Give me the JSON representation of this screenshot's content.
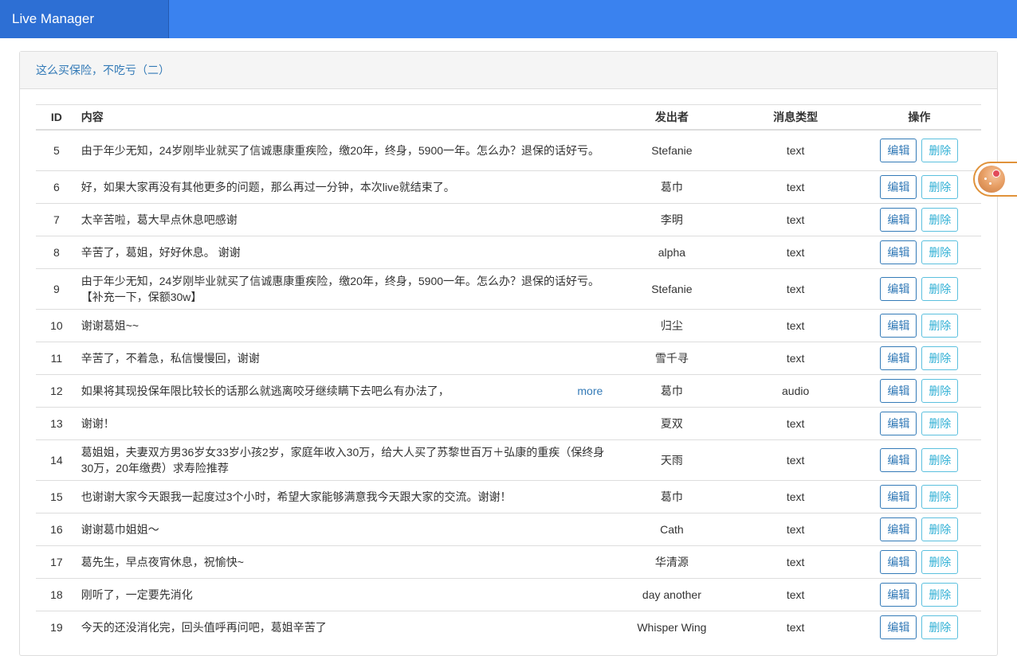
{
  "app": {
    "title": "Live Manager"
  },
  "panel": {
    "title": "这么买保险，不吃亏（二）"
  },
  "table": {
    "headers": {
      "id": "ID",
      "content": "内容",
      "sender": "发出者",
      "type": "消息类型",
      "ops": "操作"
    },
    "edit_label": "编辑",
    "delete_label": "删除",
    "more_label": "more",
    "rows": [
      {
        "id": "5",
        "content": "由于年少无知，24岁刚毕业就买了信诚惠康重疾险，缴20年，终身，5900一年。怎么办？退保的话好亏。",
        "sender": "Stefanie",
        "type": "text"
      },
      {
        "id": "6",
        "content": "好，如果大家再没有其他更多的问题，那么再过一分钟，本次live就结束了。",
        "sender": "葛巾",
        "type": "text"
      },
      {
        "id": "7",
        "content": "太辛苦啦，葛大早点休息吧感谢",
        "sender": "李明",
        "type": "text"
      },
      {
        "id": "8",
        "content": "辛苦了，葛姐，好好休息。 谢谢",
        "sender": "alpha",
        "type": "text"
      },
      {
        "id": "9",
        "content": "由于年少无知，24岁刚毕业就买了信诚惠康重疾险，缴20年，终身，5900一年。怎么办？退保的话好亏。【补充一下，保额30w】",
        "sender": "Stefanie",
        "type": "text"
      },
      {
        "id": "10",
        "content": "谢谢葛姐~~",
        "sender": "归尘",
        "type": "text"
      },
      {
        "id": "11",
        "content": "辛苦了，不着急，私信慢慢回，谢谢",
        "sender": "雪千寻",
        "type": "text"
      },
      {
        "id": "12",
        "content": "如果将其现投保年限比较长的话那么就逃离咬牙继续瞒下去吧么有办法了，",
        "sender": "葛巾",
        "type": "audio",
        "more": true
      },
      {
        "id": "13",
        "content": "谢谢！",
        "sender": "夏双",
        "type": "text"
      },
      {
        "id": "14",
        "content": "葛姐姐，夫妻双方男36岁女33岁小孩2岁，家庭年收入30万，给大人买了苏黎世百万＋弘康的重疾（保终身30万，20年缴费）求寿险推荐",
        "sender": "天雨",
        "type": "text"
      },
      {
        "id": "15",
        "content": "也谢谢大家今天跟我一起度过3个小时，希望大家能够满意我今天跟大家的交流。谢谢！",
        "sender": "葛巾",
        "type": "text"
      },
      {
        "id": "16",
        "content": "谢谢葛巾姐姐～",
        "sender": "Cath",
        "type": "text"
      },
      {
        "id": "17",
        "content": "葛先生，早点夜宵休息，祝愉快~",
        "sender": "华清源",
        "type": "text"
      },
      {
        "id": "18",
        "content": "刚听了，一定要先消化",
        "sender": "day another",
        "type": "text"
      },
      {
        "id": "19",
        "content": "今天的还没消化完，回头值呼再问吧，葛姐辛苦了",
        "sender": "Whisper Wing",
        "type": "text"
      }
    ]
  },
  "float_widget": {
    "icon": "palette-icon",
    "border_color": "#e0923a"
  },
  "colors": {
    "navbar": "#3a82ef",
    "brand": "#2d6fd4",
    "link": "#337ab7",
    "info": "#5bc0de"
  }
}
